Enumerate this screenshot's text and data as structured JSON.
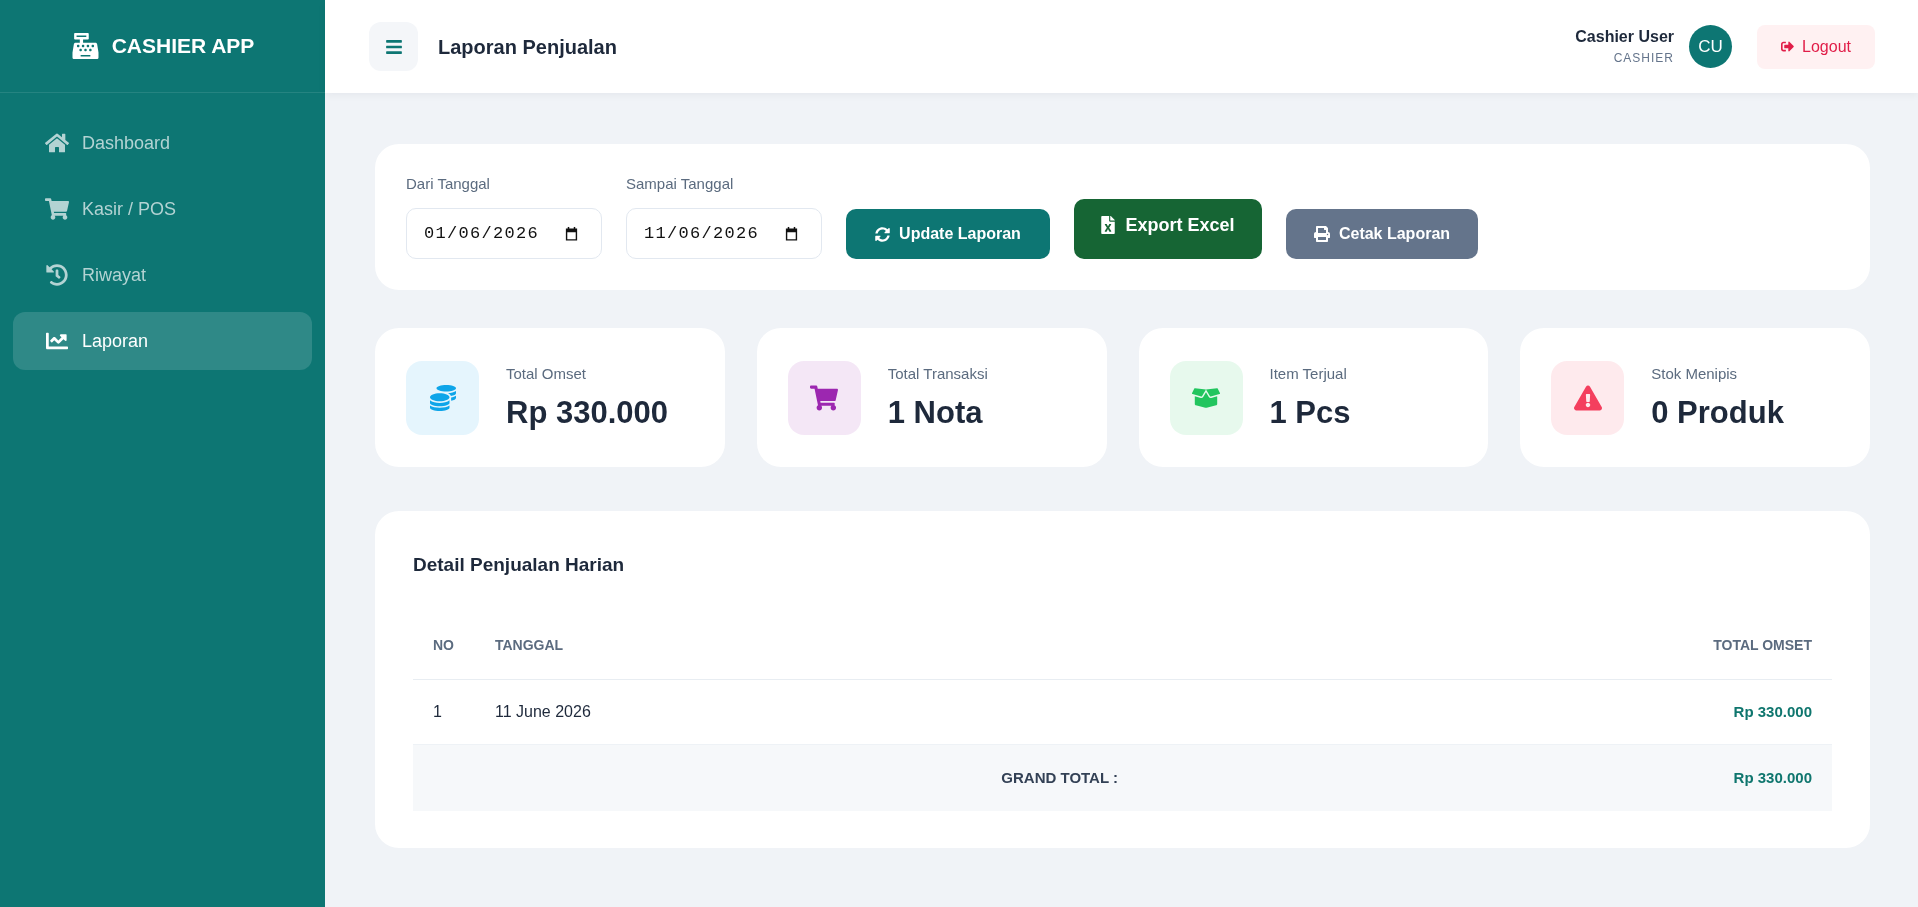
{
  "sidebar": {
    "brand": "CASHIER APP",
    "items": [
      {
        "label": "Dashboard",
        "selected": false
      },
      {
        "label": "Kasir / POS",
        "selected": false
      },
      {
        "label": "Riwayat",
        "selected": false
      },
      {
        "label": "Laporan",
        "selected": true
      }
    ]
  },
  "header": {
    "title": "Laporan Penjualan",
    "user": {
      "name": "Cashier User",
      "role": "CASHIER",
      "initials": "CU"
    },
    "logout": "Logout"
  },
  "filter": {
    "fields": [
      {
        "label": "Dari Tanggal",
        "value": "01/06/2026"
      },
      {
        "label": "Sampai Tanggal",
        "value": "11/06/2026"
      }
    ],
    "buttons": [
      {
        "label": "Update Laporan",
        "kind": "update"
      },
      {
        "label": "Export Excel",
        "kind": "export"
      },
      {
        "label": "Cetak Laporan",
        "kind": "print"
      }
    ]
  },
  "stats": [
    {
      "label": "Total Omset",
      "value": "Rp 330.000",
      "color": "#0ea5e9"
    },
    {
      "label": "Total Transaksi",
      "value": "1 Nota",
      "color": "#9c27b0"
    },
    {
      "label": "Item Terjual",
      "value": "1 Pcs",
      "color": "#22c55e"
    },
    {
      "label": "Stok Menipis",
      "value": "0 Produk",
      "color": "#f43f5e"
    }
  ],
  "table": {
    "title": "Detail Penjualan Harian",
    "columns": [
      "NO",
      "TANGGAL",
      "TOTAL OMSET"
    ],
    "rows": [
      [
        "1",
        "11 June 2026",
        "Rp 330.000"
      ]
    ],
    "footer": {
      "label": "GRAND TOTAL :",
      "value": "Rp 330.000"
    }
  }
}
